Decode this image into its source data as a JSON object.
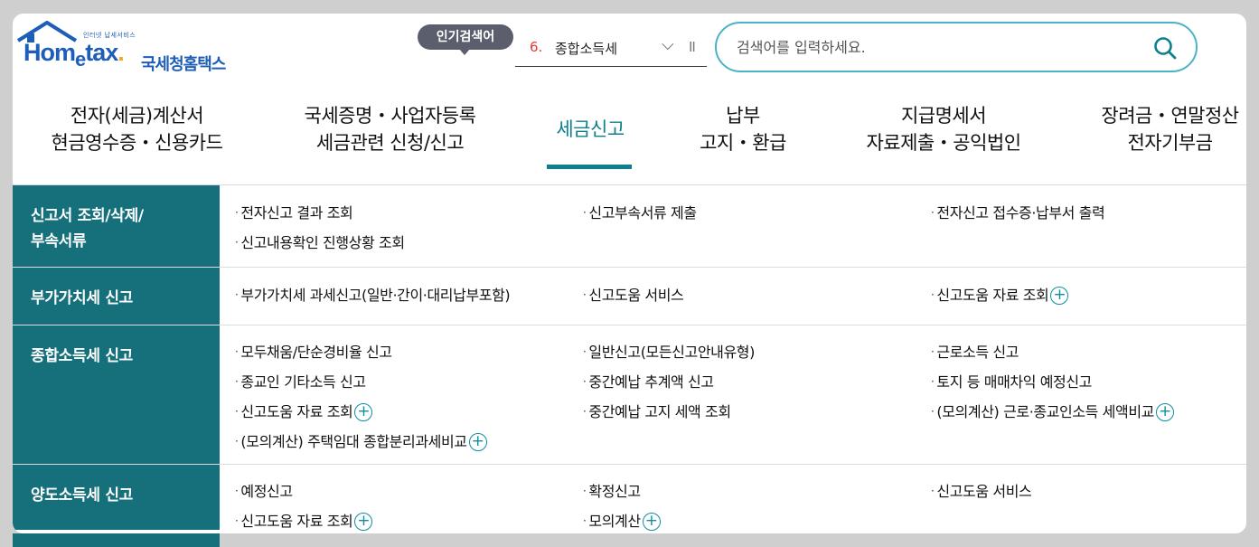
{
  "header": {
    "logo": {
      "sub_text": "인터넷 납세서비스",
      "name_en_1": "Hom",
      "name_en_2": "e",
      "name_en_3": "tax",
      "name_en_dot": ".",
      "name_kr": "국세청홈택스"
    },
    "popular": {
      "badge_label": "인기검색어",
      "rank": "6.",
      "term": "종합소득세",
      "chevron": "⌵",
      "pause": "II"
    },
    "search": {
      "placeholder": "검색어를 입력하세요.",
      "value": "",
      "icon": "search-icon"
    }
  },
  "nav": {
    "items": [
      {
        "line1": "전자(세금)계산서",
        "line2": "현금영수증・신용카드"
      },
      {
        "line1": "국세증명・사업자등록",
        "line2": "세금관련 신청/신고"
      },
      {
        "line1": "세금신고",
        "line2": ""
      },
      {
        "line1": "납부",
        "line2": "고지・환급"
      },
      {
        "line1": "지급명세서",
        "line2": "자료제출・공익법인"
      },
      {
        "line1": "장려금・연말정산",
        "line2": "전자기부금"
      }
    ],
    "active_index": 2,
    "accent_color": "#0e7f8c"
  },
  "submenu": [
    {
      "title_line1": "신고서 조회/삭제/",
      "title_line2": "부속서류",
      "items": [
        "전자신고 결과 조회",
        "신고부속서류 제출",
        "전자신고 접수증·납부서 출력",
        "신고내용확인 진행상황 조회"
      ]
    },
    {
      "title_line1": "부가가치세 신고",
      "items": [
        "부가가치세 과세신고(일반·간이·대리납부포함)",
        "신고도움 서비스",
        "신고도움 자료 조회"
      ]
    },
    {
      "title_line1": "종합소득세 신고",
      "items": [
        "모두채움/단순경비율 신고",
        "일반신고(모든신고안내유형)",
        "근로소득 신고",
        "종교인 기타소득 신고",
        "중간예납 추계액 신고",
        "토지 등 매매차익 예정신고",
        "신고도움 자료 조회",
        "중간예납 고지 세액 조회",
        "(모의계산) 근로·종교인소득 세액비교",
        "(모의계산) 주택임대 종합분리과세비교"
      ]
    },
    {
      "title_line1": "양도소득세 신고",
      "items": [
        "예정신고",
        "확정신고",
        "신고도움 서비스",
        "신고도움 자료 조회",
        "모의계산"
      ]
    }
  ],
  "expand_symbol": "+",
  "colors": {
    "header_bg": "#16707c",
    "plus": "#0e8fa0"
  }
}
